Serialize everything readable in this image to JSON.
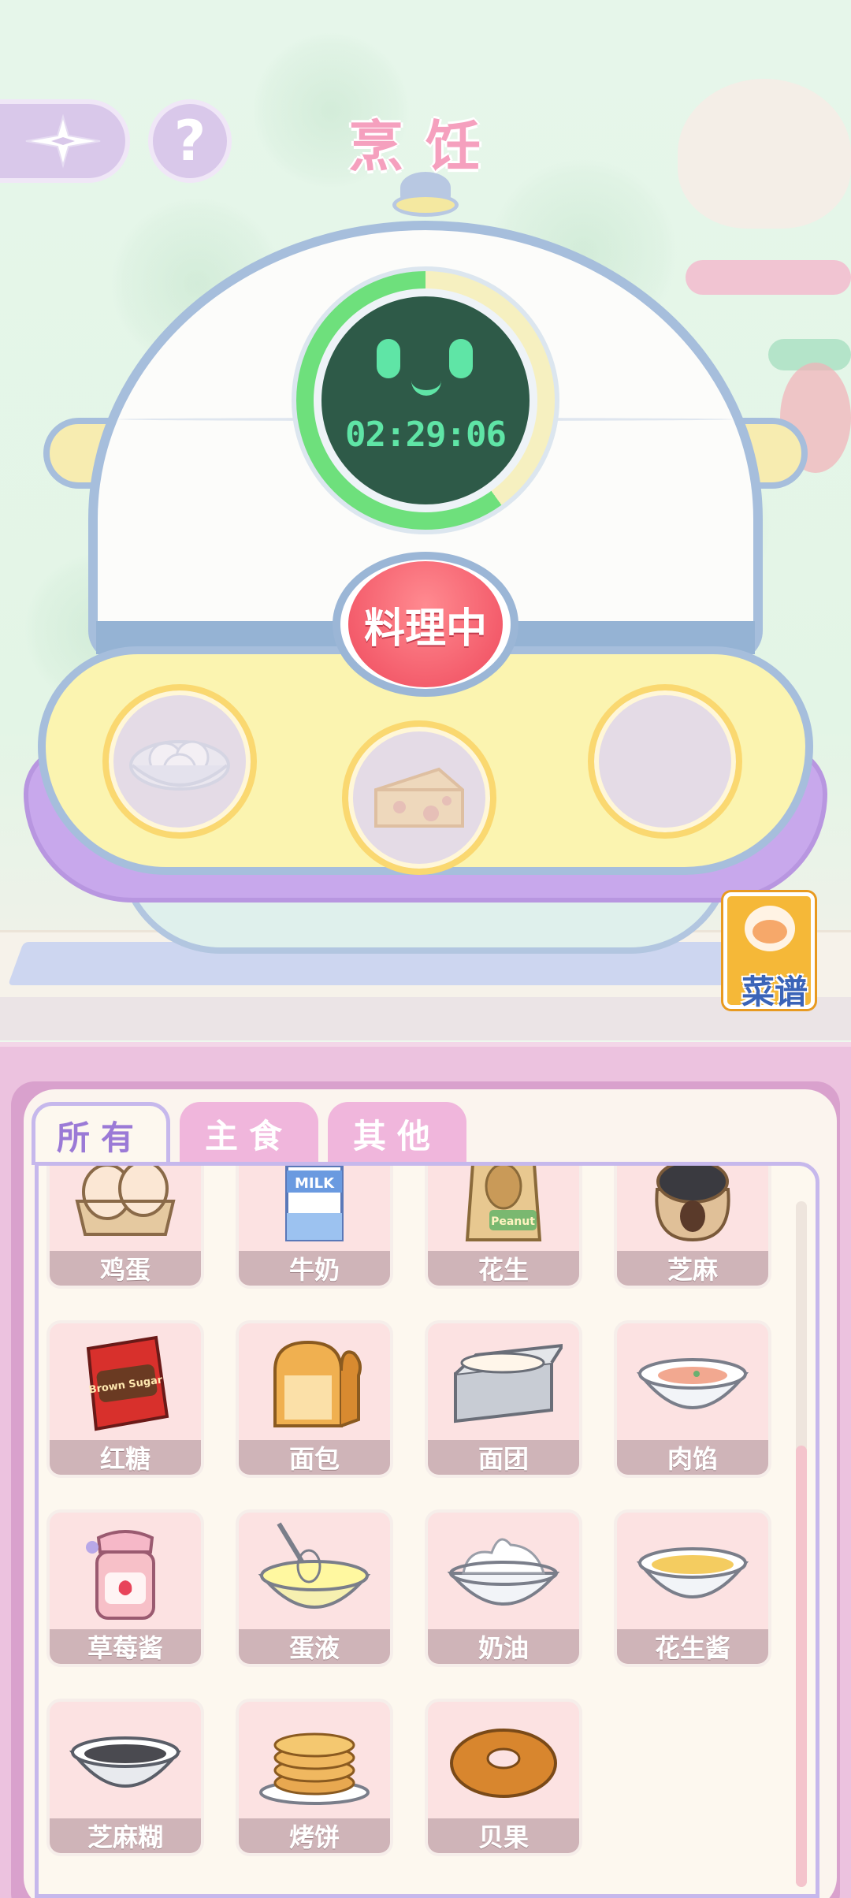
{
  "header": {
    "title": "烹饪",
    "back_icon": "four-point-star-back-icon",
    "help_label": "?"
  },
  "cooker": {
    "timer": "02:29:06",
    "timer_progress": 0.6,
    "status_button": "料理中",
    "slots": [
      {
        "icon": "egg-bowl-icon",
        "filled": true
      },
      {
        "icon": "cheese-icon",
        "filled": true
      },
      {
        "icon": "",
        "filled": false
      }
    ]
  },
  "recipe_book": {
    "label": "菜谱",
    "icon": "cat-recipe-book-icon"
  },
  "tabs": [
    {
      "label": "所有",
      "active": true
    },
    {
      "label": "主食",
      "active": false
    },
    {
      "label": "其他",
      "active": false
    }
  ],
  "ingredients": [
    {
      "name": "鸡蛋",
      "icon": "eggs-carton-icon"
    },
    {
      "name": "牛奶",
      "icon": "milk-carton-icon",
      "pic_text": "MILK"
    },
    {
      "name": "花生",
      "icon": "peanut-bag-icon",
      "pic_text": "Peanut"
    },
    {
      "name": "芝麻",
      "icon": "sesame-sack-icon"
    },
    {
      "name": "红糖",
      "icon": "brown-sugar-bag-icon",
      "pic_text": "Brown Sugar"
    },
    {
      "name": "面包",
      "icon": "bread-loaf-icon"
    },
    {
      "name": "面团",
      "icon": "dough-tin-icon"
    },
    {
      "name": "肉馅",
      "icon": "minced-meat-bowl-icon"
    },
    {
      "name": "草莓酱",
      "icon": "strawberry-jam-jar-icon"
    },
    {
      "name": "蛋液",
      "icon": "egg-liquid-bowl-icon"
    },
    {
      "name": "奶油",
      "icon": "cream-bowl-icon"
    },
    {
      "name": "花生酱",
      "icon": "peanut-butter-bowl-icon"
    },
    {
      "name": "芝麻糊",
      "icon": "sesame-paste-bowl-icon"
    },
    {
      "name": "烤饼",
      "icon": "pancakes-icon"
    },
    {
      "name": "贝果",
      "icon": "bagel-icon"
    }
  ],
  "colors": {
    "title_pink": "#f5a0be",
    "timer_green": "#5fe5a6",
    "status_red": "#f45d6c",
    "tab_active_text": "#9b7ad6",
    "label_bar": "#cfb4b8"
  }
}
